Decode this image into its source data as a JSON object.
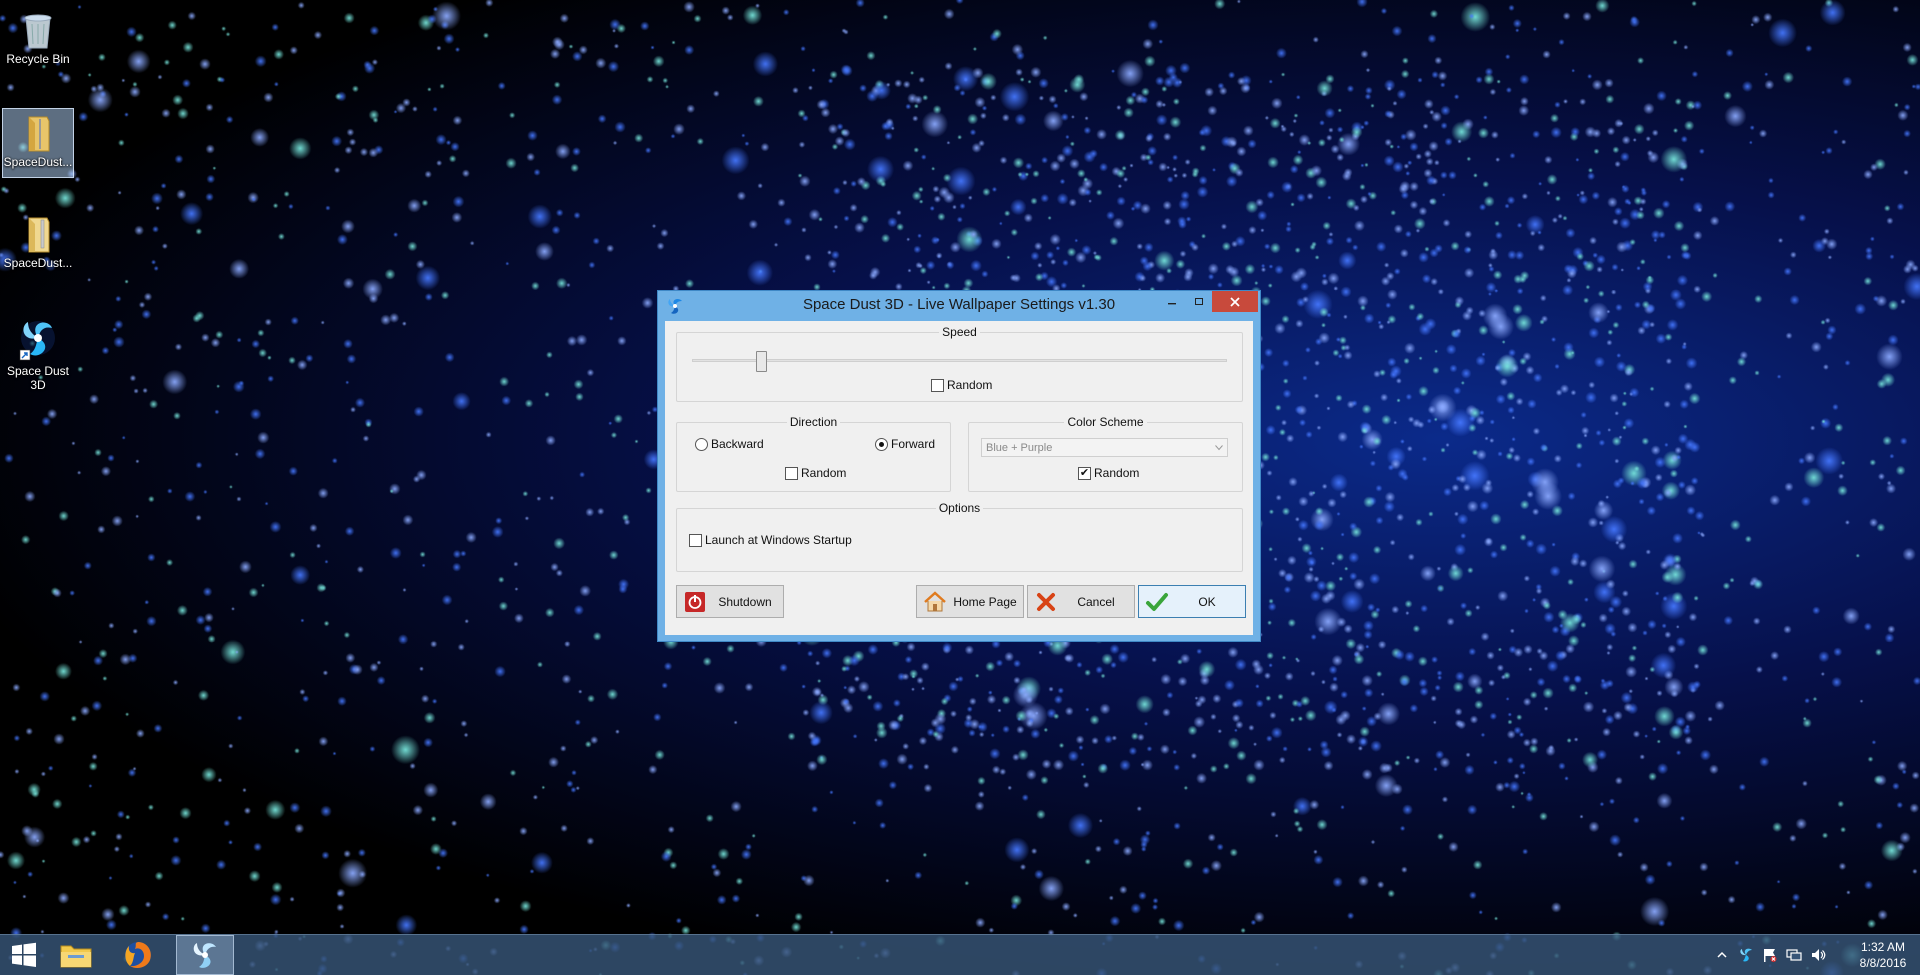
{
  "desktop": {
    "icons": [
      {
        "label": "Recycle Bin",
        "icon": "recycle-bin-icon"
      },
      {
        "label": "SpaceDust...",
        "icon": "folder-icon"
      },
      {
        "label": "SpaceDust...",
        "icon": "folder-zip-icon"
      },
      {
        "label": "Space Dust 3D",
        "icon": "space-dust-icon"
      }
    ]
  },
  "dialog": {
    "title": "Space Dust 3D - Live Wallpaper Settings  v1.30",
    "speed": {
      "group_label": "Speed",
      "slider_value": 0.13,
      "random_label": "Random",
      "random_checked": false
    },
    "direction": {
      "group_label": "Direction",
      "backward_label": "Backward",
      "forward_label": "Forward",
      "selected": "Forward",
      "random_label": "Random",
      "random_checked": false
    },
    "color_scheme": {
      "group_label": "Color Scheme",
      "selected": "Blue + Purple",
      "random_label": "Random",
      "random_checked": true
    },
    "options": {
      "group_label": "Options",
      "launch_label": "Launch at Windows Startup",
      "launch_checked": false
    },
    "buttons": {
      "shutdown": "Shutdown",
      "home_page": "Home Page",
      "cancel": "Cancel",
      "ok": "OK"
    }
  },
  "taskbar": {
    "items": [
      "start-icon",
      "file-explorer-icon",
      "firefox-icon",
      "space-dust-icon"
    ],
    "clock": {
      "time": "1:32 AM",
      "date": "8/8/2016"
    }
  },
  "colors": {
    "titlebar": "#6fb1e6",
    "close_button": "#c84a3c",
    "taskbar": "#375578"
  }
}
